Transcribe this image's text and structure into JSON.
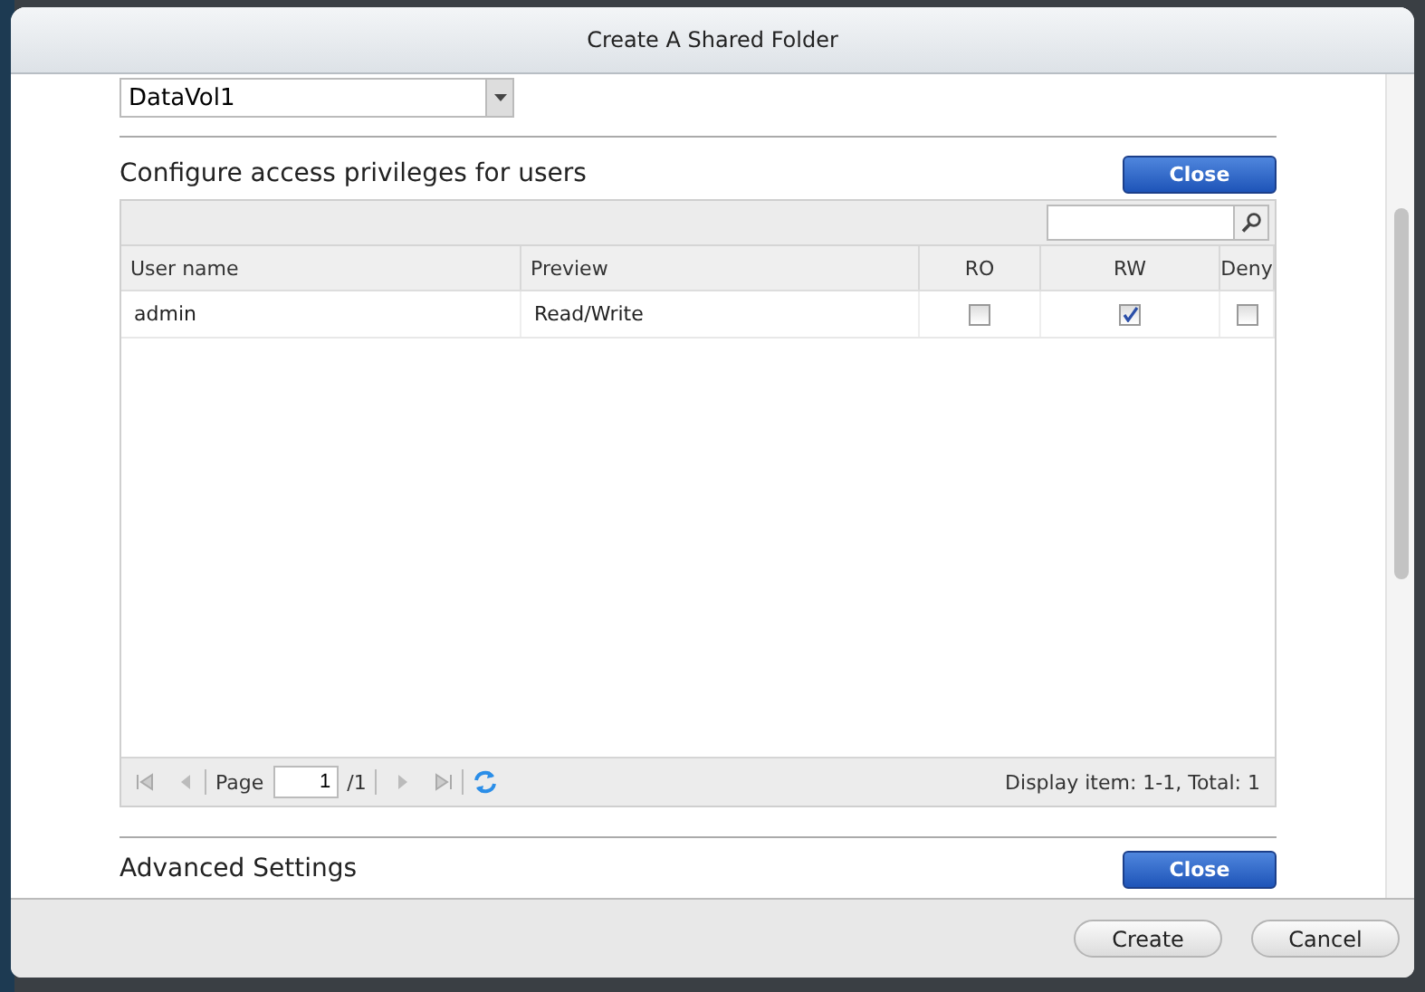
{
  "window": {
    "title": "Create A Shared Folder"
  },
  "volume_dropdown": {
    "value": "DataVol1"
  },
  "privileges": {
    "heading": "Configure access privileges for users",
    "close_button": "Close",
    "columns": [
      "User name",
      "Preview",
      "RO",
      "RW",
      "Deny"
    ],
    "rows": [
      {
        "user": "admin",
        "preview": "Read/Write",
        "ro": false,
        "rw": true,
        "deny": false
      }
    ],
    "pager": {
      "page_label": "Page",
      "page": "1",
      "of": "/1",
      "display": "Display item: 1-1, Total: 1"
    }
  },
  "advanced": {
    "heading": "Advanced Settings",
    "close_button": "Close"
  },
  "buttons": [
    "Create",
    "Cancel"
  ]
}
